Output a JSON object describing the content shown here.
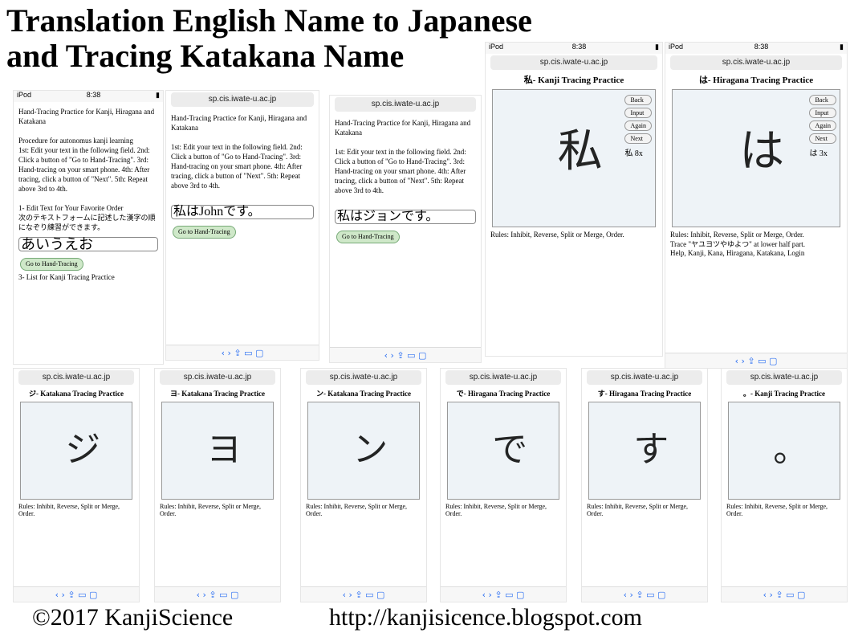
{
  "title_line1": "Translation English Name to Japanese",
  "title_line2": "and Tracing Katakana Name",
  "footer_left": "©2017 KanjiScience",
  "footer_right": "http://kanjisicence.blogspot.com",
  "url": "sp.cis.iwate-u.ac.jp",
  "time": "8:38",
  "doc_intro": "Hand-Tracing Practice for Kanji, Hiragana and Katakana",
  "doc_proc": "Procedure for autonomus kanji learning",
  "doc_steps": "1st: Edit your text in the following field. 2nd: Click a button of \"Go to Hand-Tracing\". 3rd: Hand-tracing on your smart phone. 4th: After tracing, click a button of \"Next\". 5th: Repeat above 3rd to 4th.",
  "doc_sec1": "1- Edit Text for Your Favorite Order",
  "doc_jp": "次のテキストフォームに記述した漢字の順になぞり練習ができます。",
  "doc_sec3": "3- List for Kanji Tracing Practice",
  "go_btn": "Go to Hand-Tracing",
  "doc_text1": "あいうえお",
  "doc_text2": "私はJohnです。",
  "doc_text3": "私はジョンです。",
  "p_kanji": {
    "title": "私- Kanji Tracing Practice",
    "glyph": "私",
    "count": "私 8x"
  },
  "p_hira": {
    "title": "は- Hiragana Tracing Practice",
    "glyph": "は",
    "count": "は 3x"
  },
  "small": [
    {
      "title": "ジ- Katakana Tracing Practice",
      "glyph": "ジ"
    },
    {
      "title": "ヨ- Katakana Tracing Practice",
      "glyph": "ヨ"
    },
    {
      "title": "ン- Katakana Tracing Practice",
      "glyph": "ン"
    },
    {
      "title": "で- Hiragana Tracing Practice",
      "glyph": "で"
    },
    {
      "title": "す- Hiragana Tracing Practice",
      "glyph": "す"
    },
    {
      "title": "。- Kanji Tracing Practice",
      "glyph": "。"
    }
  ],
  "buttons": [
    "Back",
    "Input",
    "Again",
    "Next"
  ],
  "rules": "Rules: Inhibit, Reverse, Split or Merge, Order.",
  "trace": "Trace \"ヤユヨツやゆよつ\" at lower half part.",
  "help": "Help, Kanji, Kana, Hiragana, Katakana, Login"
}
